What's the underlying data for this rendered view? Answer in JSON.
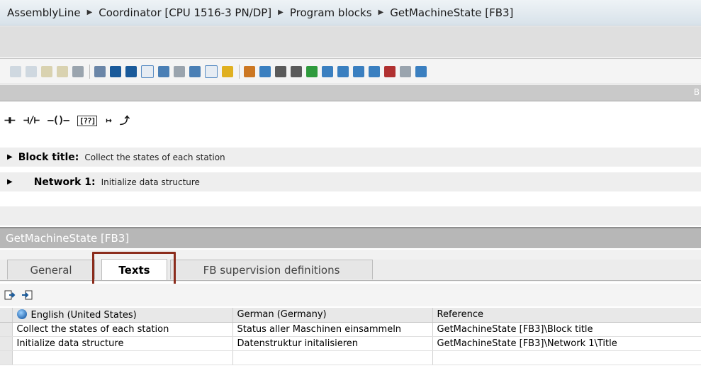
{
  "breadcrumb": [
    "AssemblyLine",
    "Coordinator [CPU 1516-3 PN/DP]",
    "Program blocks",
    "GetMachineState [FB3]"
  ],
  "gray_bar_letter": "B",
  "ladder_elements": [
    {
      "label": "⊣⊢",
      "name": "contact-no-icon"
    },
    {
      "label": "⊣/⊢",
      "name": "contact-nc-icon"
    },
    {
      "label": "–()–",
      "name": "coil-icon"
    },
    {
      "label": "[??]",
      "name": "empty-box-icon"
    },
    {
      "label": "↦",
      "name": "open-branch-icon"
    },
    {
      "label": "⤴",
      "name": "close-branch-icon"
    }
  ],
  "block_title": {
    "label": "Block title:",
    "text": "Collect the states of each station"
  },
  "network1": {
    "label": "Network 1:",
    "text": "Initialize data structure"
  },
  "panel": {
    "title": "GetMachineState [FB3]"
  },
  "tabs": [
    {
      "label": "General",
      "active": false
    },
    {
      "label": "Texts",
      "active": true
    },
    {
      "label": "FB supervision definitions",
      "active": false
    }
  ],
  "table": {
    "headers": [
      "English (United States)",
      "German (Germany)",
      "Reference"
    ],
    "rows": [
      [
        "Collect the states of each station",
        "Status aller Maschinen einsammeln",
        "GetMachineState [FB3]\\Block title"
      ],
      [
        "Initialize data structure",
        "Datenstruktur initalisieren",
        "GetMachineState [FB3]\\Network 1\\Title"
      ]
    ]
  },
  "colors": {
    "highlight": "#8b2c1c",
    "accent": "#2f6fb5"
  }
}
